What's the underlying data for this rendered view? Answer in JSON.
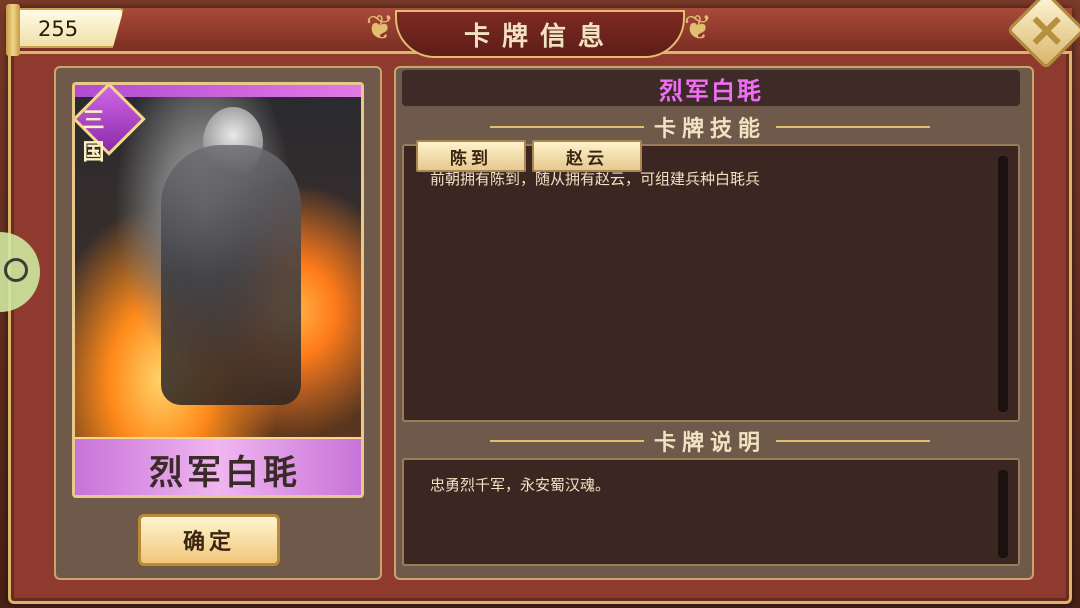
{
  "header": {
    "title": "卡牌信息",
    "resource_value": "255"
  },
  "card": {
    "name": "烈军白毦",
    "badge": "三国",
    "confirm_label": "确定"
  },
  "info": {
    "name": "烈军白毦",
    "skill_section_title": "卡牌技能",
    "skill_text": "前朝拥有陈到，随从拥有赵云，可组建兵种白毦兵",
    "required_generals": [
      "陈到",
      "赵云"
    ],
    "description_section_title": "卡牌说明",
    "description_text": "忠勇烈千军，永安蜀汉魂。"
  },
  "colors": {
    "frame": "#8f3a2e",
    "gold": "#e3bd70",
    "panel": "#6e594b",
    "dark_box": "#3b2621",
    "name_pink": "#f06ef5"
  }
}
